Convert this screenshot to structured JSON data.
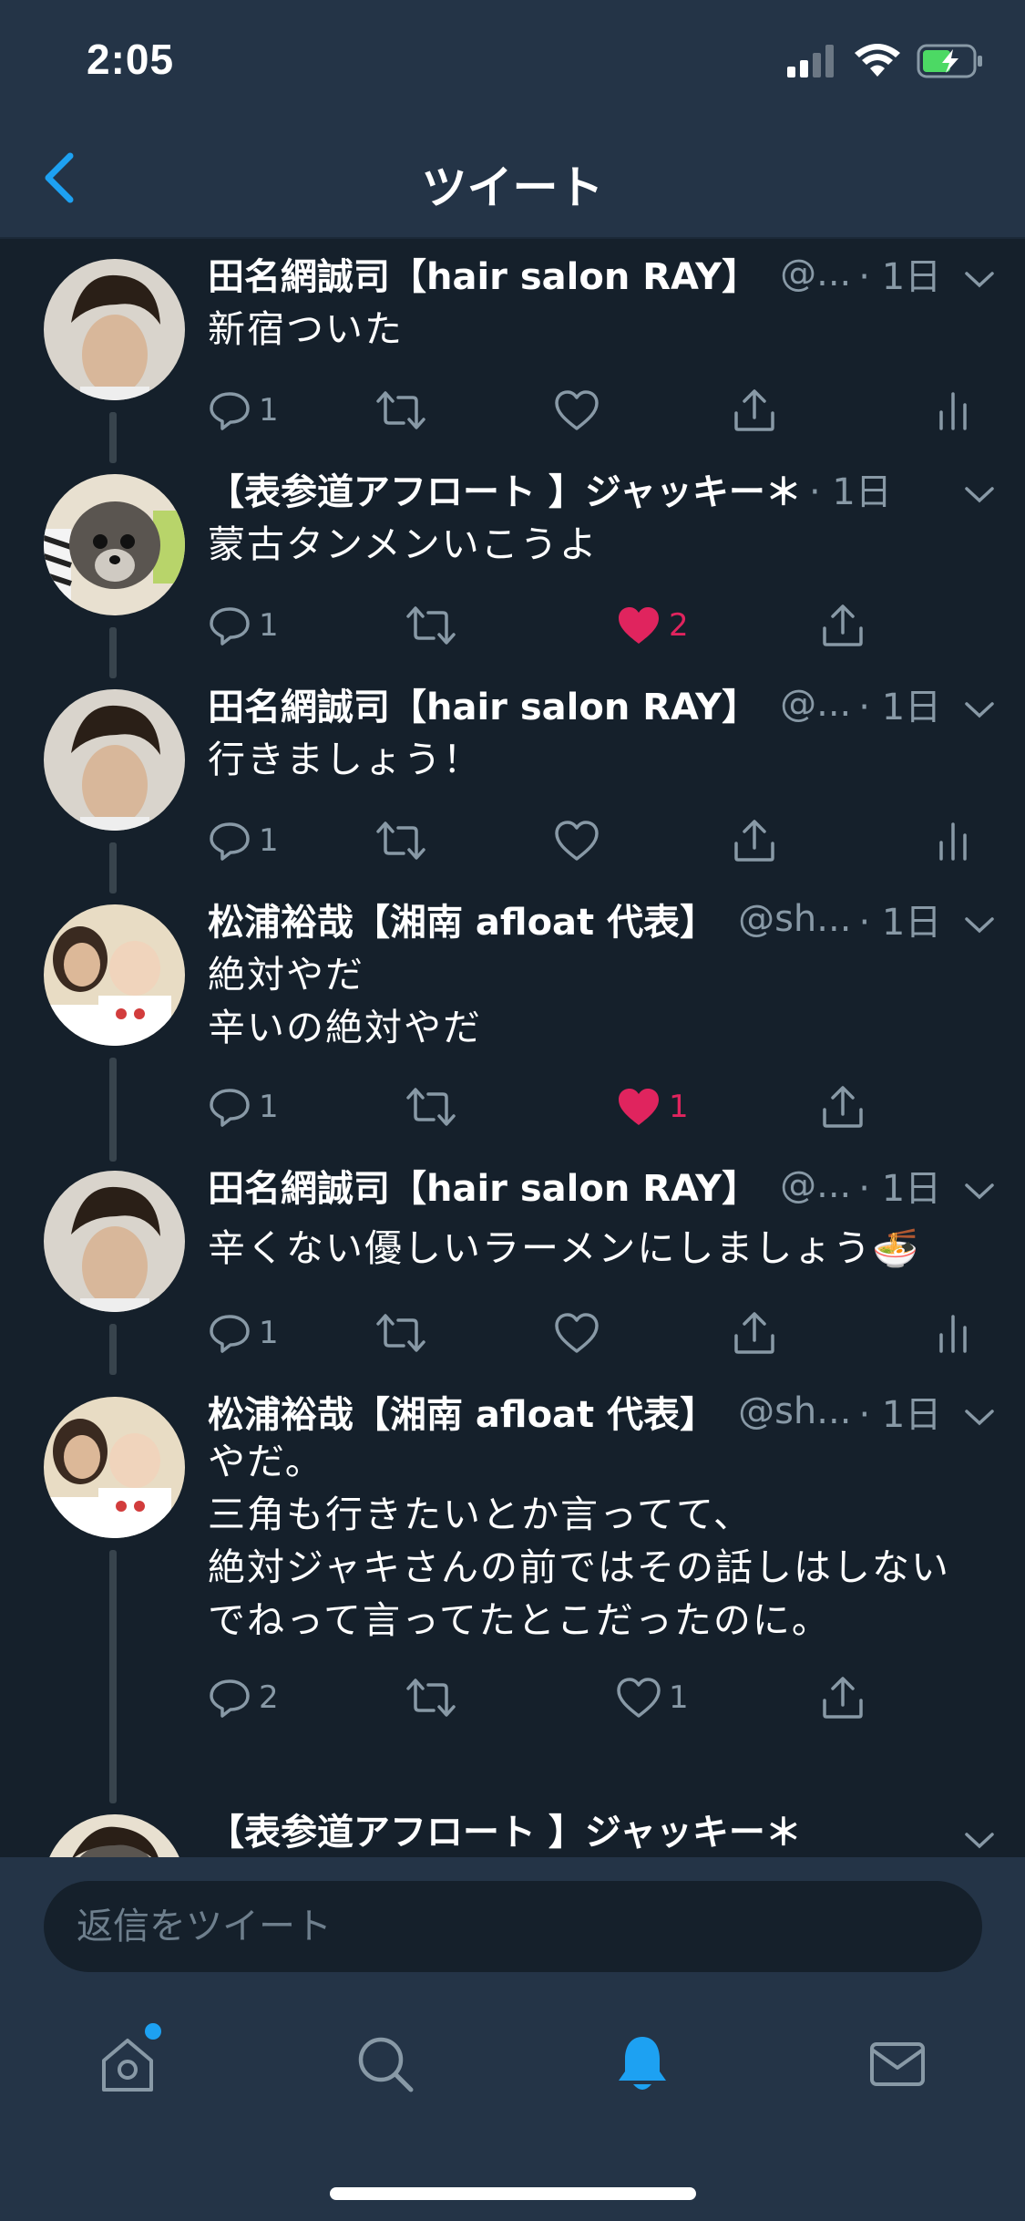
{
  "status_bar": {
    "time": "2:05"
  },
  "nav": {
    "title": "ツイート"
  },
  "tweets": [
    {
      "name": "田名網誠司【hair salon RAY】",
      "handle": "@...",
      "time": "· 1日",
      "text": "新宿ついた",
      "reply_count": "1",
      "like_count": "",
      "liked": false,
      "avatar": "man"
    },
    {
      "name": "【表参道アフロート 】ジャッキー＊",
      "handle": "",
      "time": "· 1日",
      "text": "蒙古タンメンいこうよ",
      "reply_count": "1",
      "like_count": "2",
      "liked": true,
      "avatar": "dog"
    },
    {
      "name": "田名網誠司【hair salon RAY】",
      "handle": "@...",
      "time": "· 1日",
      "text": "行きましょう！",
      "reply_count": "1",
      "like_count": "",
      "liked": false,
      "avatar": "man"
    },
    {
      "name": "松浦裕哉【湘南 afloat 代表】",
      "handle": "@sh...",
      "time": "· 1日",
      "text": "絶対やだ\n辛いの絶対やだ",
      "reply_count": "1",
      "like_count": "1",
      "liked": true,
      "avatar": "baby"
    },
    {
      "name": "田名網誠司【hair salon RAY】",
      "handle": "@...",
      "time": "· 1日",
      "text": "辛くない優しいラーメンにしましょう🍜",
      "reply_count": "1",
      "like_count": "",
      "liked": false,
      "avatar": "man"
    },
    {
      "name": "松浦裕哉【湘南 afloat 代表】",
      "handle": "@sh...",
      "time": "· 1日",
      "text": "やだ。\n三角も行きたいとか言ってて、\n絶対ジャキさんの前ではその話しはしない\nでねって言ってたとこだったのに。",
      "reply_count": "2",
      "like_count": "1",
      "liked": false,
      "avatar": "baby"
    },
    {
      "name": "【表参道アフロート 】ジャッキー＊",
      "handle": "",
      "time": "",
      "text": "",
      "reply_count": "",
      "like_count": "",
      "liked": false,
      "avatar": "dog"
    }
  ],
  "reply": {
    "placeholder": "返信をツイート"
  },
  "colors": {
    "background": "#15202b",
    "bar": "#243447",
    "secondary_text": "#8899a6",
    "like": "#e0245e",
    "accent": "#1da1f2"
  },
  "icons": [
    "back-chevron-icon",
    "reply-icon",
    "retweet-icon",
    "heart-icon",
    "share-icon",
    "analytics-icon",
    "caret-down-icon",
    "home-icon",
    "search-icon",
    "bell-icon",
    "mail-icon"
  ]
}
